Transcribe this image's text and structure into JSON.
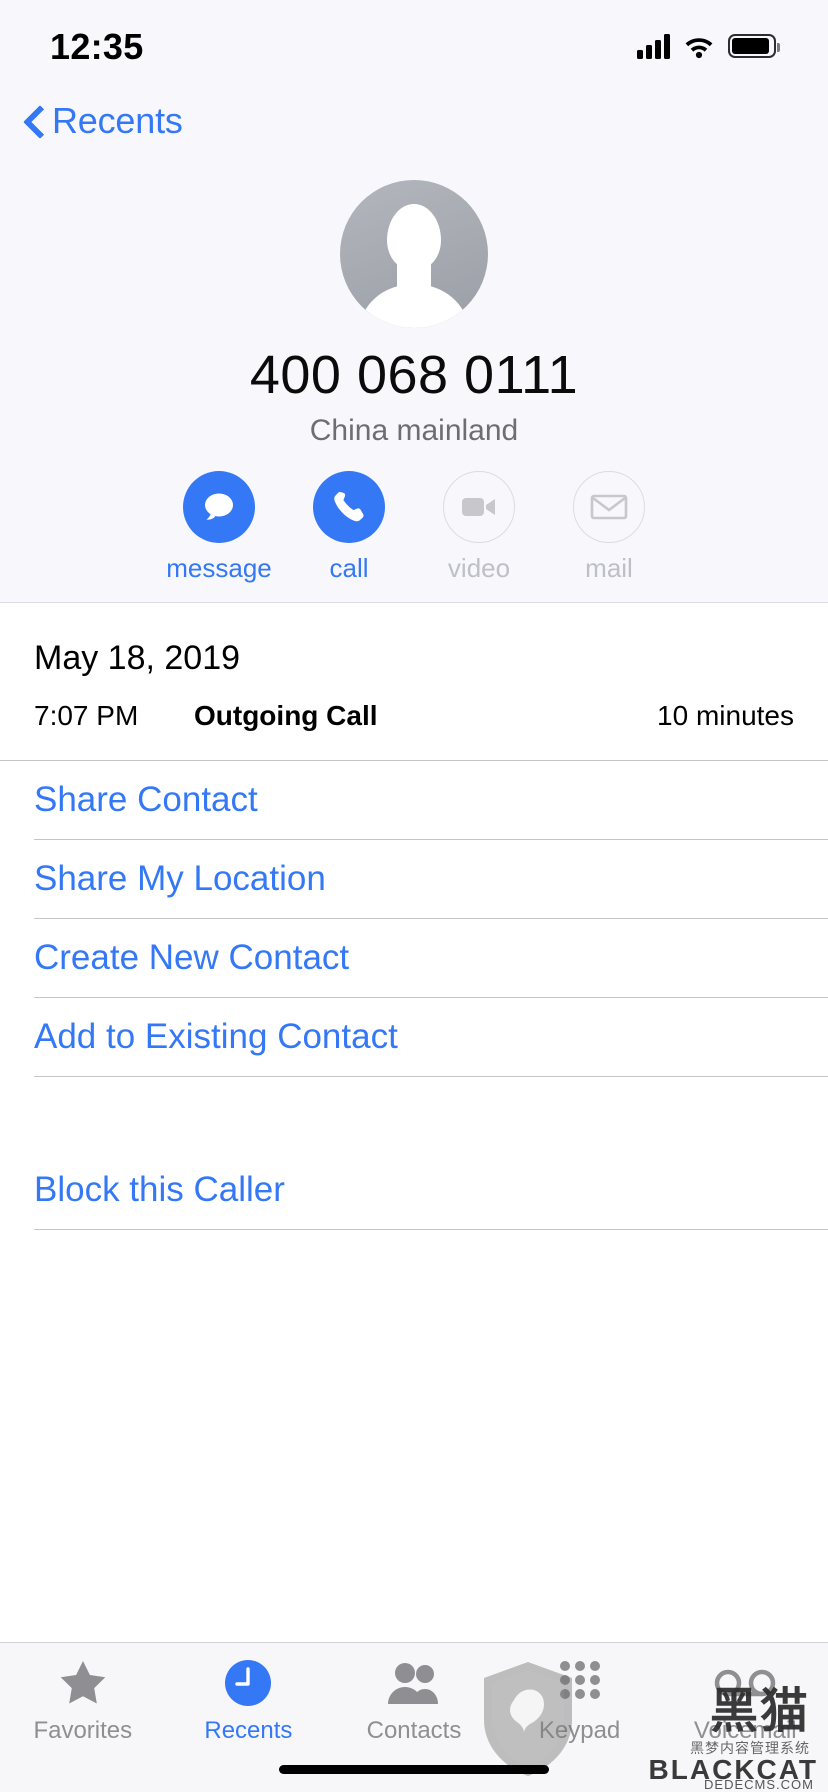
{
  "status_bar": {
    "time": "12:35",
    "signal_icon": "cellular-signal-icon",
    "wifi_icon": "wifi-icon",
    "battery_icon": "battery-icon"
  },
  "nav": {
    "back_label": "Recents",
    "back_icon": "chevron-left-icon"
  },
  "contact": {
    "avatar_icon": "person-placeholder-avatar",
    "phone_number": "400 068 0111",
    "locale": "China mainland",
    "actions": [
      {
        "label": "message",
        "icon": "message-bubble-icon",
        "enabled": true
      },
      {
        "label": "call",
        "icon": "phone-handset-icon",
        "enabled": true
      },
      {
        "label": "video",
        "icon": "video-camera-icon",
        "enabled": false
      },
      {
        "label": "mail",
        "icon": "envelope-icon",
        "enabled": false
      }
    ]
  },
  "call_detail": {
    "date": "May 18, 2019",
    "time": "7:07 PM",
    "type": "Outgoing Call",
    "duration": "10 minutes"
  },
  "action_list": [
    {
      "label": "Share Contact"
    },
    {
      "label": "Share My Location"
    },
    {
      "label": "Create New Contact"
    },
    {
      "label": "Add to Existing Contact"
    }
  ],
  "block_section": [
    {
      "label": "Block this Caller"
    }
  ],
  "tab_bar": [
    {
      "label": "Favorites",
      "icon": "star-icon",
      "active": false
    },
    {
      "label": "Recents",
      "icon": "clock-icon",
      "active": true
    },
    {
      "label": "Contacts",
      "icon": "people-icon",
      "active": false
    },
    {
      "label": "Keypad",
      "icon": "keypad-dots-icon",
      "active": false
    },
    {
      "label": "Voicemail",
      "icon": "voicemail-icon",
      "active": false
    }
  ],
  "watermark": {
    "shield_icon": "shield-cat-logo",
    "chinese": "黑猫",
    "subtitle": "黑梦内容管理系统",
    "brand": "BLACKCAT",
    "dede": "DEDECMS.COM"
  },
  "colors": {
    "accent_blue": "#3478f6",
    "header_bg": "#f7f7fc",
    "disabled_gray": "#bfc0c5",
    "secondary_text": "#6d6d72"
  }
}
